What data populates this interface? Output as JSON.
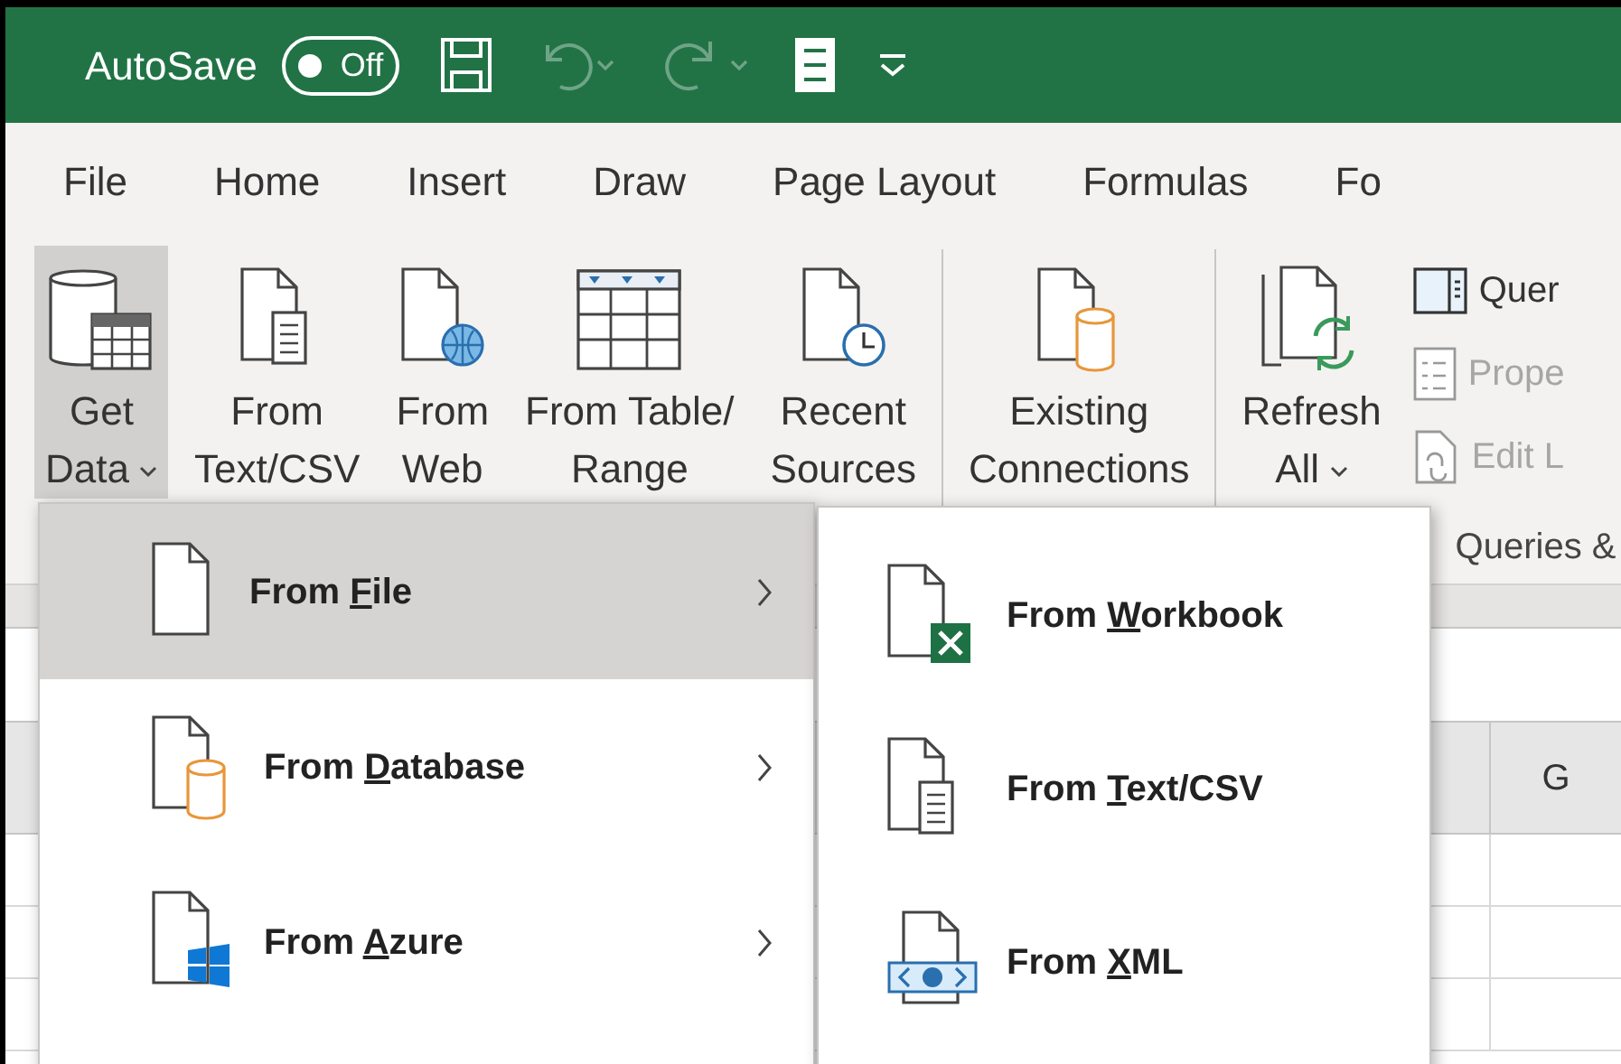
{
  "title_bar": {
    "autosave_label": "AutoSave",
    "autosave": {
      "label": "Off",
      "on": false
    },
    "quick_access": [
      {
        "kind": "save",
        "disabled": false
      },
      {
        "kind": "undo",
        "disabled": true
      },
      {
        "kind": "redo",
        "disabled": true
      },
      {
        "kind": "form",
        "disabled": false
      },
      {
        "kind": "customize",
        "disabled": false
      }
    ]
  },
  "tabs": [
    {
      "label": "File",
      "selected": false
    },
    {
      "label": "Home",
      "selected": false
    },
    {
      "label": "Insert",
      "selected": false
    },
    {
      "label": "Draw",
      "selected": false
    },
    {
      "label": "Page Layout",
      "selected": false
    },
    {
      "label": "Formulas",
      "selected": false
    },
    {
      "label": "Fo",
      "selected": false
    }
  ],
  "ribbon": {
    "groups": [
      {
        "buttons": [
          {
            "kind": "get_data",
            "lines": [
              "Get",
              "Data"
            ],
            "has_dropdown": true,
            "selected": true
          },
          {
            "kind": "text_csv",
            "lines": [
              "From",
              "Text/CSV"
            ],
            "has_dropdown": false,
            "selected": false
          },
          {
            "kind": "web",
            "lines": [
              "From",
              "Web"
            ],
            "has_dropdown": false,
            "selected": false
          },
          {
            "kind": "table",
            "lines": [
              "From Table/",
              "Range"
            ],
            "has_dropdown": false,
            "selected": false
          },
          {
            "kind": "recent",
            "lines": [
              "Recent",
              "Sources"
            ],
            "has_dropdown": false,
            "selected": false
          }
        ]
      },
      {
        "buttons": [
          {
            "kind": "existing",
            "lines": [
              "Existing",
              "Connections"
            ],
            "has_dropdown": false,
            "selected": false
          }
        ]
      },
      {
        "buttons": [
          {
            "kind": "refresh",
            "lines": [
              "Refresh",
              "All"
            ],
            "has_dropdown": true,
            "selected": false
          }
        ],
        "small_buttons": [
          {
            "kind": "queries",
            "label": "Quer",
            "disabled": false
          },
          {
            "kind": "properties",
            "label": "Prope",
            "disabled": true
          },
          {
            "kind": "edit_links",
            "label": "Edit L",
            "disabled": true
          }
        ],
        "label": "Queries &"
      }
    ]
  },
  "sheet": {
    "column_header": "G"
  },
  "menu": {
    "items": [
      {
        "kind": "file",
        "label_before": "From ",
        "access_key": "F",
        "label_after": "ile",
        "has_submenu": true,
        "selected": true
      },
      {
        "kind": "database",
        "label_before": "From ",
        "access_key": "D",
        "label_after": "atabase",
        "has_submenu": true,
        "selected": false
      },
      {
        "kind": "azure",
        "label_before": "From ",
        "access_key": "A",
        "label_after": "zure",
        "has_submenu": true,
        "selected": false
      }
    ]
  },
  "submenu": {
    "items": [
      {
        "kind": "workbook",
        "label_before": "From ",
        "access_key": "W",
        "label_after": "orkbook",
        "selected": false
      },
      {
        "kind": "text_csv",
        "label_before": "From ",
        "access_key": "T",
        "label_after": "ext/CSV",
        "selected": false
      },
      {
        "kind": "xml",
        "label_before": "From ",
        "access_key": "X",
        "label_after": "ML",
        "selected": false
      }
    ]
  }
}
